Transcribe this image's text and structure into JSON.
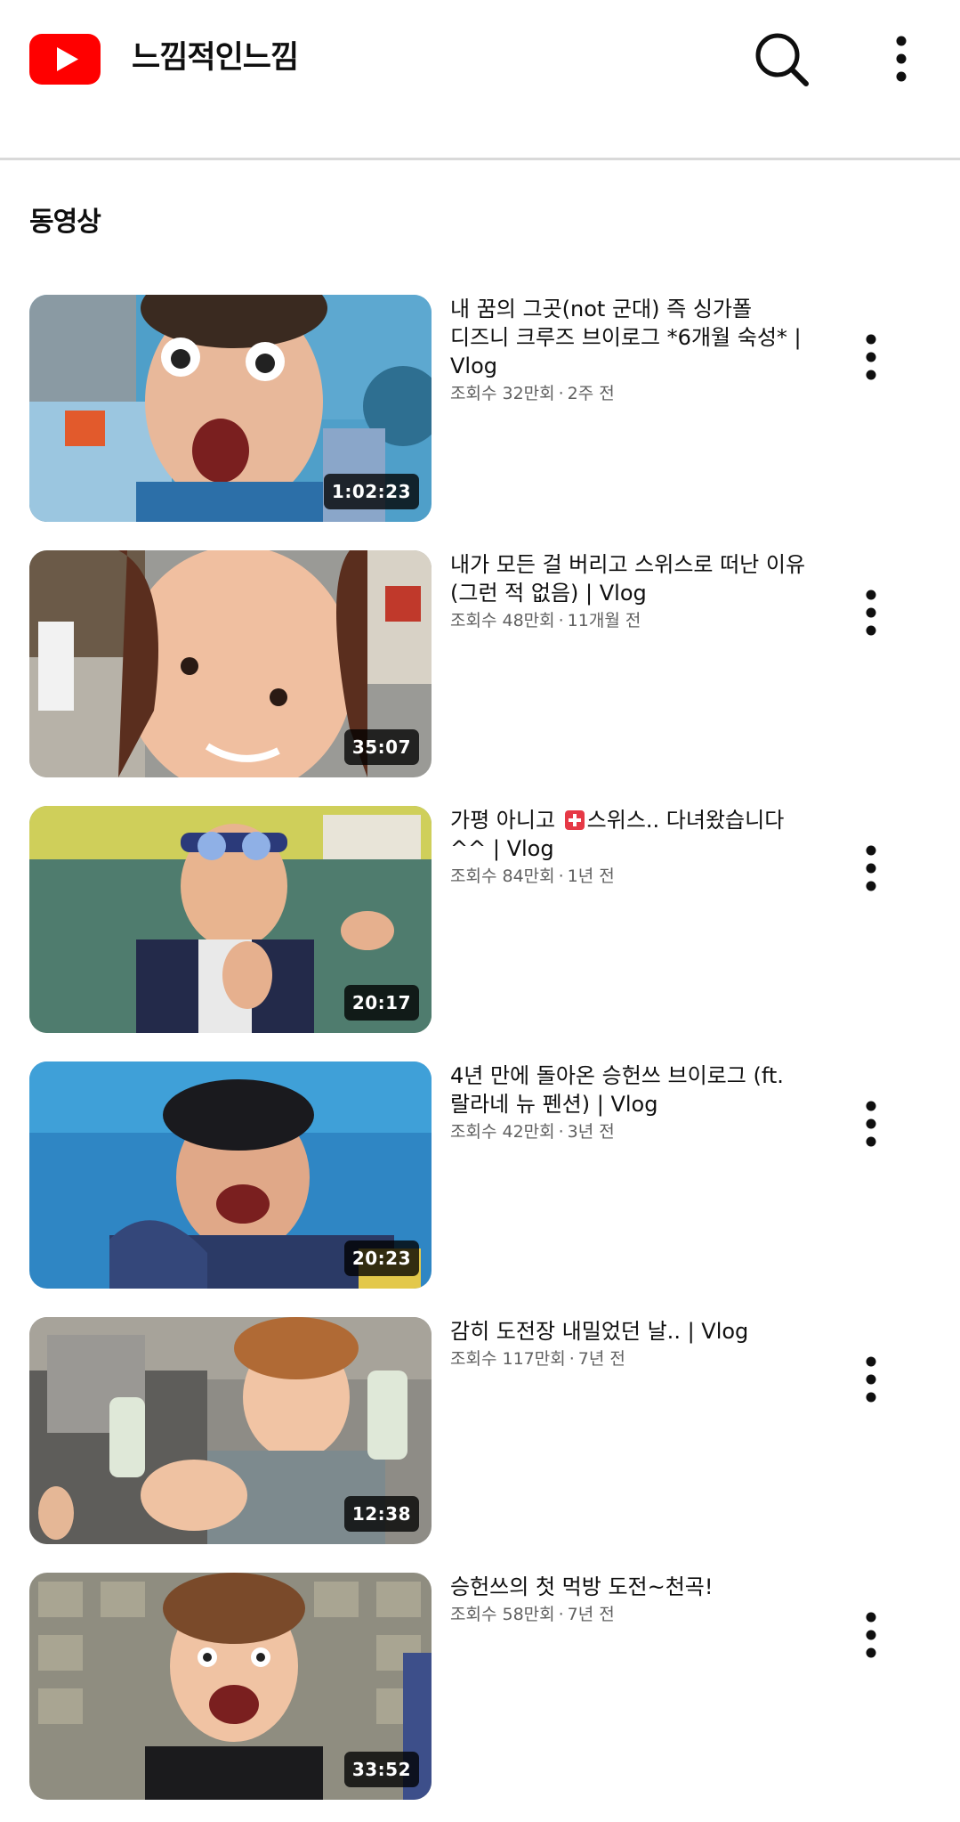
{
  "header": {
    "channel_name": "느낌적인느낌",
    "logo_icon": "youtube-logo-icon",
    "search_icon": "search-icon",
    "more_icon": "more-vert-icon",
    "brand_color": "#ff0000"
  },
  "section": {
    "title": "동영상"
  },
  "videos": [
    {
      "title": "내 꿈의 그곳(not 군대) 즉 싱가폴 디즈니 크루즈 브이로그 *6개월 숙성* | Vlog",
      "views": "조회수 32만회",
      "age": "2주 전",
      "duration": "1:02:23"
    },
    {
      "title": "내가 모든 걸 버리고 스위스로 떠난 이유 (그런 적 없음) | Vlog",
      "views": "조회수 48만회",
      "age": "11개월 전",
      "duration": "35:07"
    },
    {
      "title_before": "가평 아니고 ",
      "flag_icon": "swiss-flag-icon",
      "title_after": "스위스.. 다녀왔습니다 ^^ | Vlog",
      "views": "조회수 84만회",
      "age": "1년 전",
      "duration": "20:17"
    },
    {
      "title": "4년 만에 돌아온 승헌쓰 브이로그 (ft. 랄라네 뉴 펜션) | Vlog",
      "views": "조회수 42만회",
      "age": "3년 전",
      "duration": "20:23"
    },
    {
      "title": "감히 도전장 내밀었던 날.. | Vlog",
      "views": "조회수 117만회",
      "age": "7년 전",
      "duration": "12:38"
    },
    {
      "title": "승헌쓰의 첫 먹방 도전~천곡!",
      "views": "조회수 58만회",
      "age": "7년 전",
      "duration": "33:52"
    }
  ]
}
